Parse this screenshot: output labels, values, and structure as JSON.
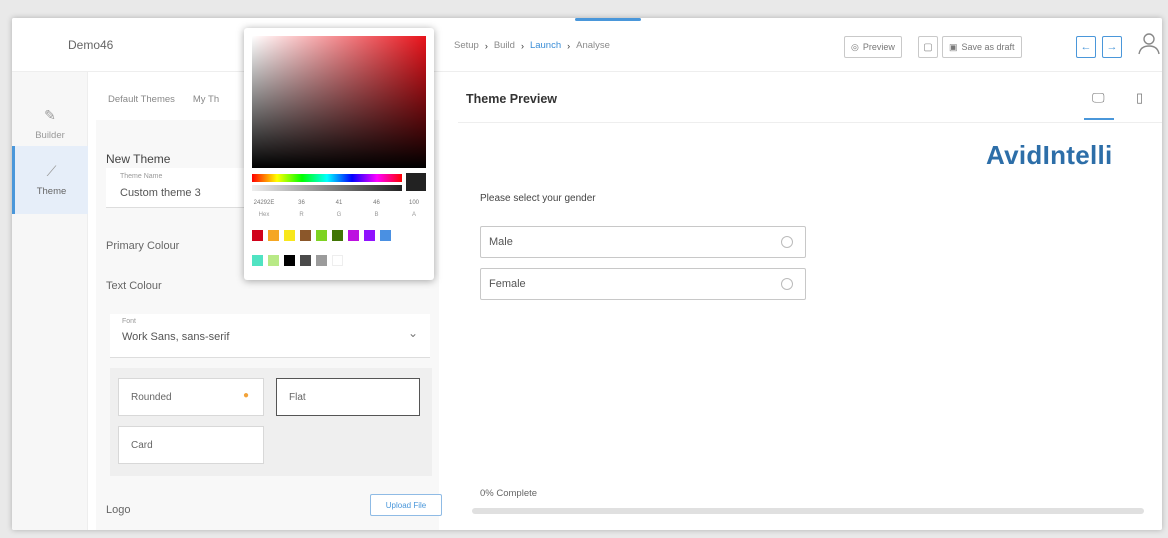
{
  "header": {
    "project_name": "Demo46",
    "steps": [
      "Setup",
      "Build",
      "Launch",
      "Analyse"
    ],
    "active_step": "Launch",
    "preview_label": "Preview",
    "save_draft_label": "Save as draft"
  },
  "rail": {
    "items": [
      {
        "label": "Builder",
        "icon": "pen-icon"
      },
      {
        "label": "Theme",
        "icon": "brush-icon"
      }
    ]
  },
  "panel": {
    "tabs": [
      "Default Themes",
      "My Th"
    ],
    "new_theme_heading": "New Theme",
    "theme_name_label": "Theme Name",
    "theme_name_value": "Custom theme 3",
    "primary_colour_label": "Primary Colour",
    "text_colour_label": "Text Colour",
    "font_label": "Font",
    "font_value": "Work Sans, sans-serif",
    "styles": [
      "Rounded",
      "Flat",
      "Card"
    ],
    "selected_style": "Rounded",
    "logo_label": "Logo",
    "upload_label": "Upload File"
  },
  "color_picker": {
    "hex": "24292E",
    "r": "36",
    "g": "41",
    "b": "46",
    "a": "100",
    "labels": [
      "Hex",
      "R",
      "G",
      "B",
      "A"
    ],
    "swatches": [
      "#d0021b",
      "#f5a623",
      "#f8e71c",
      "#8b572a",
      "#7ed321",
      "#417505",
      "#bd10e0",
      "#9013fe",
      "#4a90e2",
      "#50e3c2",
      "#b8e986",
      "#000000",
      "#4a4a4a",
      "#9b9b9b",
      "#ffffff"
    ]
  },
  "preview": {
    "title": "Theme Preview",
    "brand": "AvidIntelli",
    "question": "Please select your gender",
    "options": [
      "Male",
      "Female"
    ],
    "progress_label": "0% Complete",
    "progress": 0
  }
}
